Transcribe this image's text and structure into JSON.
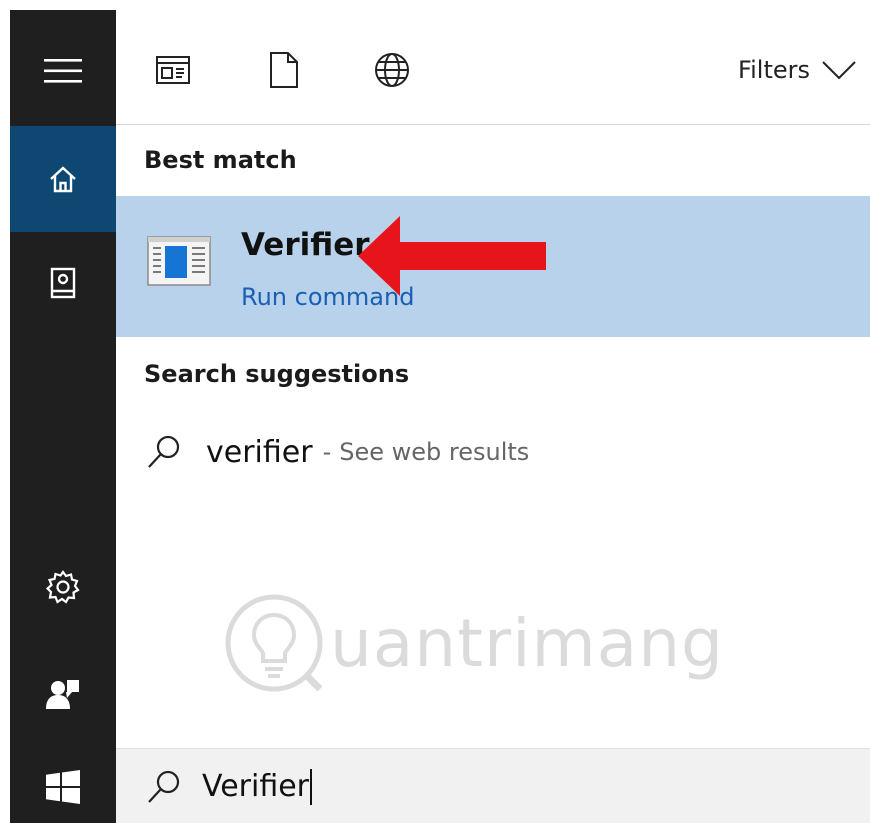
{
  "header": {
    "filters_label": "Filters",
    "icons": [
      "apps-icon",
      "document-icon",
      "web-globe-icon",
      "chevron-down-icon"
    ]
  },
  "rail": {
    "icons": [
      "hamburger-menu-icon",
      "home-icon",
      "notebook-icon",
      "settings-gear-icon",
      "account-icon",
      "windows-start-icon"
    ]
  },
  "best_match": {
    "title": "Best match",
    "app_name": "Verifier",
    "app_type": "Run command"
  },
  "suggestions": {
    "title": "Search suggestions",
    "items": [
      {
        "term": "verifier",
        "separator": "-",
        "hint": "See web results"
      }
    ]
  },
  "search": {
    "value": "Verifier"
  },
  "colors": {
    "rail_bg": "#1f1f1f",
    "rail_active": "#0e4771",
    "selected_row": "#b7d2ea",
    "link_blue": "#1a5fb4",
    "arrow_red": "#e8141b"
  }
}
